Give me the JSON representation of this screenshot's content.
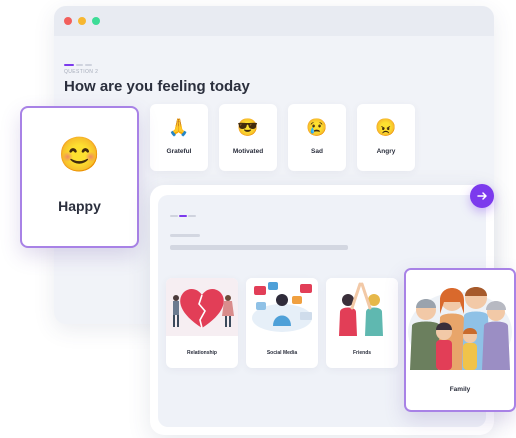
{
  "colors": {
    "accent": "#7c3aed",
    "card_border": "#a882e6"
  },
  "window": {
    "controls": [
      "close",
      "minimize",
      "maximize"
    ]
  },
  "question": {
    "number": "QUESTION 2",
    "title": "How are you feeling today"
  },
  "moods": [
    {
      "label": "Happy",
      "emoji": "😊",
      "icon": "smiling-face-icon",
      "selected": true
    },
    {
      "label": "Grateful",
      "emoji": "🙏",
      "icon": "praying-hands-icon"
    },
    {
      "label": "Motivated",
      "emoji": "😎",
      "icon": "sunglasses-face-icon"
    },
    {
      "label": "Sad",
      "emoji": "😢",
      "icon": "crying-face-icon"
    },
    {
      "label": "Angry",
      "emoji": "😠",
      "icon": "angry-face-icon"
    }
  ],
  "next_icon": "arrow-right-icon",
  "topics": [
    {
      "label": "Relationship",
      "illustration": "broken-heart-couple"
    },
    {
      "label": "Social Media",
      "illustration": "social-media-woman"
    },
    {
      "label": "Friends",
      "illustration": "friends-high-five"
    },
    {
      "label": "Family",
      "illustration": "family-group",
      "selected": true
    }
  ]
}
